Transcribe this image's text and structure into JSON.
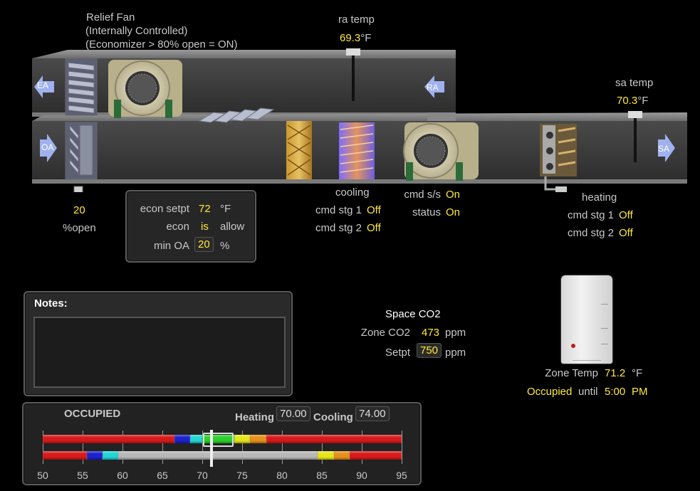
{
  "relief_fan": {
    "line1": "Relief Fan",
    "line2": "(Internally Controlled)",
    "line3": "(Economizer > 80% open = ON)"
  },
  "ra_temp": {
    "label": "ra temp",
    "value": "69.3",
    "unit": "°F"
  },
  "sa_temp": {
    "label": "sa temp",
    "value": "70.3",
    "unit": "°F"
  },
  "duct_labels": {
    "ea": "EA",
    "ra": "RA",
    "oa": "OA",
    "sa": "SA"
  },
  "damper": {
    "value": "20",
    "label": "%open"
  },
  "econ_panel": {
    "setpt_label": "econ setpt",
    "setpt_value": "72",
    "setpt_unit": "°F",
    "econ_label": "econ",
    "econ_value": "is",
    "econ_suffix": "allow",
    "minoa_label": "min OA",
    "minoa_value": "20",
    "minoa_unit": "%"
  },
  "cooling": {
    "title": "cooling",
    "stg1_label": "cmd stg 1",
    "stg1_value": "Off",
    "stg2_label": "cmd stg 2",
    "stg2_value": "Off"
  },
  "supply_fan": {
    "cmd_label": "cmd s/s",
    "cmd_value": "On",
    "status_label": "status",
    "status_value": "On"
  },
  "heating": {
    "title": "heating",
    "stg1_label": "cmd stg 1",
    "stg1_value": "Off",
    "stg2_label": "cmd stg 2",
    "stg2_value": "Off"
  },
  "notes": {
    "title": "Notes:"
  },
  "co2": {
    "title": "Space CO2",
    "zone_label": "Zone CO2",
    "zone_value": "473",
    "zone_unit": "ppm",
    "setpt_label": "Setpt",
    "setpt_value": "750",
    "setpt_unit": "ppm"
  },
  "zone": {
    "temp_label": "Zone Temp",
    "temp_value": "71.2",
    "temp_unit": "°F",
    "occ_label": "Occupied",
    "until_label": "until",
    "time_value": "5:00",
    "ampm": "PM"
  },
  "setpoint_panel": {
    "mode": "OCCUPIED",
    "heating_label": "Heating",
    "heating_value": "70.00",
    "cooling_label": "Cooling",
    "cooling_value": "74.00",
    "scale_min": 50,
    "scale_max": 95,
    "ticks": [
      "50",
      "55",
      "60",
      "65",
      "70",
      "75",
      "80",
      "85",
      "90",
      "95"
    ],
    "current_temp": 71.2,
    "occupied_bar": [
      {
        "from": 50,
        "to": 66.5,
        "color": "#d91a1a"
      },
      {
        "from": 66.5,
        "to": 68.5,
        "color": "#1c22d0"
      },
      {
        "from": 68.5,
        "to": 70,
        "color": "#22d6d6"
      },
      {
        "from": 70,
        "to": 74,
        "color": "#2bd12b"
      },
      {
        "from": 74,
        "to": 76,
        "color": "#e6e61a"
      },
      {
        "from": 76,
        "to": 78,
        "color": "#e8901a"
      },
      {
        "from": 78,
        "to": 95,
        "color": "#d91a1a"
      }
    ],
    "unoccupied_bar": [
      {
        "from": 50,
        "to": 55.5,
        "color": "#d91a1a"
      },
      {
        "from": 55.5,
        "to": 57.5,
        "color": "#1c22d0"
      },
      {
        "from": 57.5,
        "to": 59.5,
        "color": "#22d6d6"
      },
      {
        "from": 59.5,
        "to": 84.5,
        "color": "#b8b8b8"
      },
      {
        "from": 84.5,
        "to": 86.5,
        "color": "#e6e61a"
      },
      {
        "from": 86.5,
        "to": 88.5,
        "color": "#e8901a"
      },
      {
        "from": 88.5,
        "to": 95,
        "color": "#d91a1a"
      }
    ]
  }
}
